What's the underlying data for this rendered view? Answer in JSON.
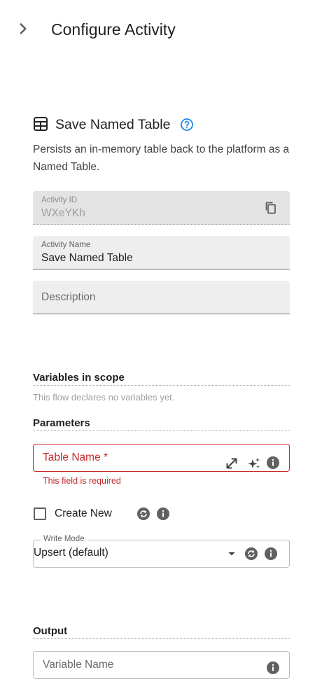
{
  "header": {
    "title": "Configure Activity",
    "collapse_icon": "chevron-right-icon"
  },
  "activity": {
    "type_name": "Save Named Table",
    "type_icon": "table-grid-icon",
    "help_icon": "help-circle-icon",
    "description": "Persists an in-memory table back to the platform as a Named Table."
  },
  "fields": {
    "activity_id": {
      "label": "Activity ID",
      "value": "WXeYKh",
      "disabled": true
    },
    "activity_name": {
      "label": "Activity Name",
      "value": "Save Named Table"
    },
    "description": {
      "placeholder": "Description",
      "value": ""
    }
  },
  "variables": {
    "title": "Variables in scope",
    "empty_note": "This flow declares no variables yet."
  },
  "parameters": {
    "title": "Parameters",
    "table_name": {
      "label": "Table Name *",
      "error": "This field is required",
      "required": true,
      "icons": [
        "expand-arrows-icon",
        "sparkles-icon",
        "info-icon"
      ]
    },
    "create_new": {
      "label": "Create New",
      "checked": false,
      "icons": [
        "sync-icon",
        "info-icon"
      ]
    },
    "write_mode": {
      "label": "Write Mode",
      "value": "Upsert (default)",
      "icons": [
        "dropdown-arrow-icon",
        "sync-icon",
        "info-icon"
      ]
    }
  },
  "output": {
    "title": "Output",
    "variable_name": {
      "placeholder": "Variable Name",
      "icons": [
        "info-icon"
      ]
    }
  },
  "colors": {
    "error": "#c62828",
    "accent_help": "#1e88e5",
    "icon_dark": "#616161",
    "field_bg": "#eeeeee"
  }
}
